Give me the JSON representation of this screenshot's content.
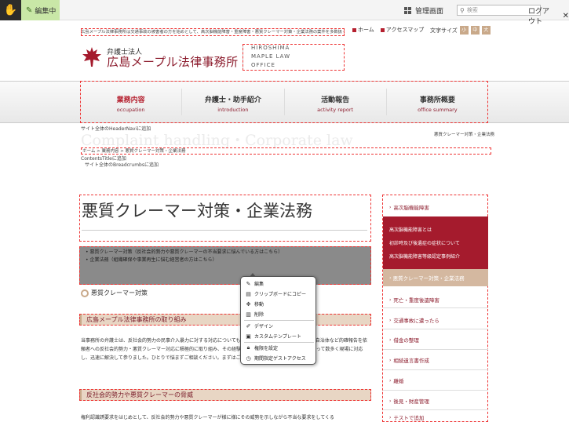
{
  "topbar": {
    "edit_label": "編集中",
    "admin_label": "管理画面",
    "search_placeholder": "検索",
    "logout_label": "ログアウト"
  },
  "header": {
    "tagline": "広島メープル法律事務所は交通事故の被害者の方を始めとして、高次脳機能障害・重度障害・悪質クレーマー対策・企業法務の案件を多数扱っております。",
    "brand_sub": "弁護士法人",
    "brand_main": "広島メープル法律事務所",
    "brand_en": [
      "HIROSHIMA",
      "MAPLE LAW",
      "OFFICE"
    ],
    "links": [
      "ホーム",
      "アクセスマップ"
    ],
    "fontsize_label": "文字サイズ",
    "fontsize_buttons": [
      "小",
      "中",
      "大"
    ]
  },
  "nav": {
    "items": [
      {
        "jp": "業務内容",
        "en": "occupation"
      },
      {
        "jp": "弁護士・助手紹介",
        "en": "introduction"
      },
      {
        "jp": "活動報告",
        "en": "activity report"
      },
      {
        "jp": "事務所概要",
        "en": "office summary"
      }
    ],
    "note": "サイト全体のHeaderNaviに追加"
  },
  "title_band": {
    "big": "Complaint handling・Corporate law",
    "crumb_right": "悪質クレーマー対策・企業法務",
    "crumb": "ホーム > 業務内容 > 悪質クレーマー対策・企業法務",
    "contents_note": "ContentsTitleに追加",
    "breadcrumb_note": "サイト全体のBreadcrumbsに追加"
  },
  "main": {
    "title": "悪質クレーマー対策・企業法務",
    "list": [
      "悪質クレーマー対策（反社会的勢力や悪質クレーマーの不当要求に悩んでいる方はこちら）",
      "企業法務（組織確保や事業再生に悩む経営者の方はこちら）"
    ],
    "sub1": "悪質クレーマー対策",
    "banner1": "広島メープル法律事務所の取り組み",
    "para1": "当事務所の弁護士は、反社会的勢力の民事介入暴力に対する対応についても研鑽を積み、その経験をふまえて、自治体など的確報告を依頼者への反社会的勢力・悪質クレーマー対応に積極的に取り組み、その経験をもとに、あるいはご相談者に代わって数多く現場に対応し、迅速に解決して参りました。ひとりで悩まずご相談ください。まずはご相談ください。",
    "banner2": "反社会的勢力や悪質クレーマーの脅威",
    "para2": "権利認識誘要求をはじめとして、反社会的勢力や悪質クレーマーが様に様にその威勢を示しながら不当な要求をしてくる"
  },
  "sidebar": {
    "top": "高次脳機能障害",
    "active_items": [
      "高次脳機能障害とは",
      "初診時及び後遺症の症状について",
      "高次脳機能障害等級認定事例紹介"
    ],
    "current": "悪質クレーマー対策・企業法務",
    "items": [
      "死亡・重度後遺障害",
      "交通事故に遭ったら",
      "借金の整理",
      "相続遺言書作成",
      "離婚",
      "後見・財産管理",
      "テストで追加"
    ]
  },
  "context_menu": {
    "items": [
      {
        "icon": "pencil-icon",
        "label": "編集"
      },
      {
        "icon": "clipboard-icon",
        "label": "クリップボードにコピー"
      },
      {
        "icon": "move-icon",
        "label": "移動"
      },
      {
        "icon": "trash-icon",
        "label": "削除"
      },
      {
        "icon": "design-icon",
        "label": "デザイン"
      },
      {
        "icon": "template-icon",
        "label": "カスタムテンプレート"
      },
      {
        "icon": "lock-icon",
        "label": "権限を設定"
      },
      {
        "icon": "clock-lock-icon",
        "label": "期間指定ゲストアクセス"
      }
    ]
  },
  "colors": {
    "brand": "#8c1c2d",
    "accent": "#a51b2d",
    "edit_bar": "#c9e7a7",
    "tan": "#c9a98a"
  }
}
